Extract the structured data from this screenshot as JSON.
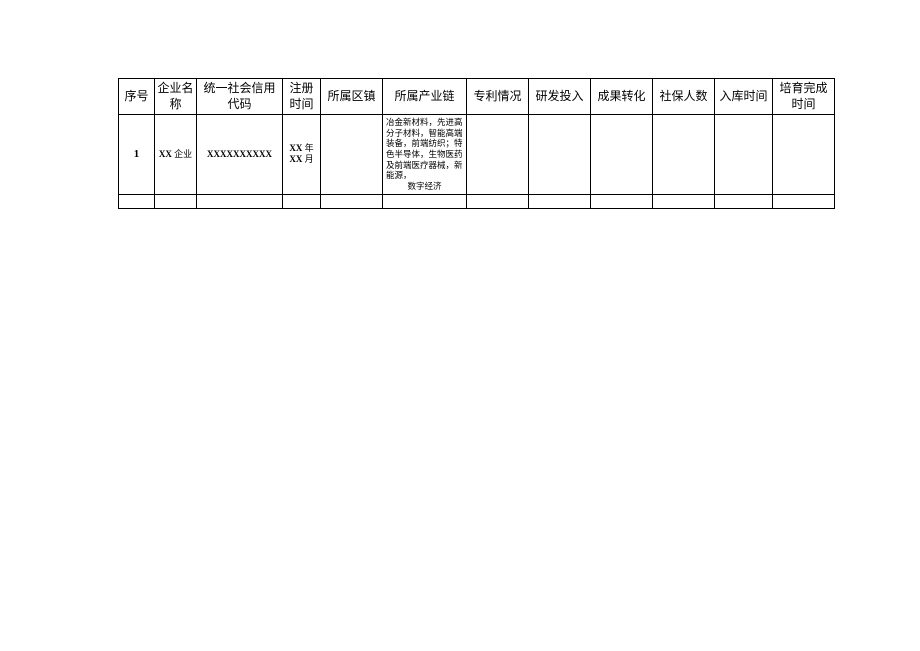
{
  "headers": {
    "seq": "序号",
    "name": "企业名称",
    "code": "统一社会信用代码",
    "reg": "注册时间",
    "region": "所属区镇",
    "chain": "所属产业链",
    "patent": "专利情况",
    "rd": "研发投入",
    "result": "成果转化",
    "social": "社保人数",
    "intime": "入库时间",
    "done": "培育完成时间"
  },
  "rows": [
    {
      "seq": "1",
      "name_prefix": "XX",
      "name_suffix": " 企业",
      "code": "XXXXXXXXXX",
      "reg_prefix1": "XX",
      "reg_suffix1": " 年",
      "reg_prefix2": "XX",
      "reg_suffix2": " 月",
      "region": "",
      "chain_main": "冶金新材料，先进高分子材料，智能高端装备，前端纺织；特色半导体，生物医药及前端医疗器械，新能源，",
      "chain_last": "数字经济",
      "patent": "",
      "rd": "",
      "result": "",
      "social": "",
      "intime": "",
      "done": ""
    }
  ]
}
